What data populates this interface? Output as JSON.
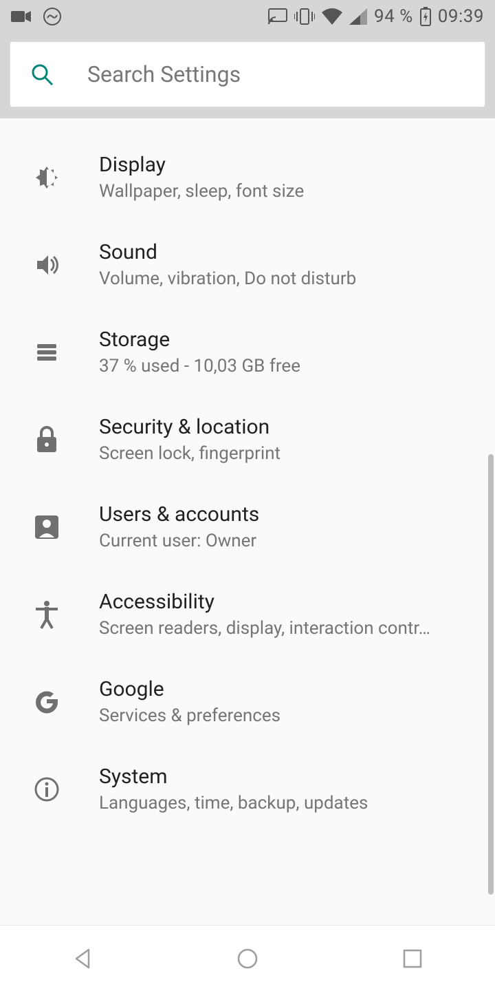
{
  "statusbar": {
    "battery_pct": "94 %",
    "time": "09:39"
  },
  "search": {
    "placeholder": "Search Settings"
  },
  "items": [
    {
      "title": "Display",
      "subtitle": "Wallpaper, sleep, font size"
    },
    {
      "title": "Sound",
      "subtitle": "Volume, vibration, Do not disturb"
    },
    {
      "title": "Storage",
      "subtitle": "37 % used - 10,03 GB free"
    },
    {
      "title": "Security & location",
      "subtitle": "Screen lock, fingerprint"
    },
    {
      "title": "Users & accounts",
      "subtitle": "Current user: Owner"
    },
    {
      "title": "Accessibility",
      "subtitle": "Screen readers, display, interaction contr…"
    },
    {
      "title": "Google",
      "subtitle": "Services & preferences"
    },
    {
      "title": "System",
      "subtitle": "Languages, time, backup, updates"
    }
  ]
}
